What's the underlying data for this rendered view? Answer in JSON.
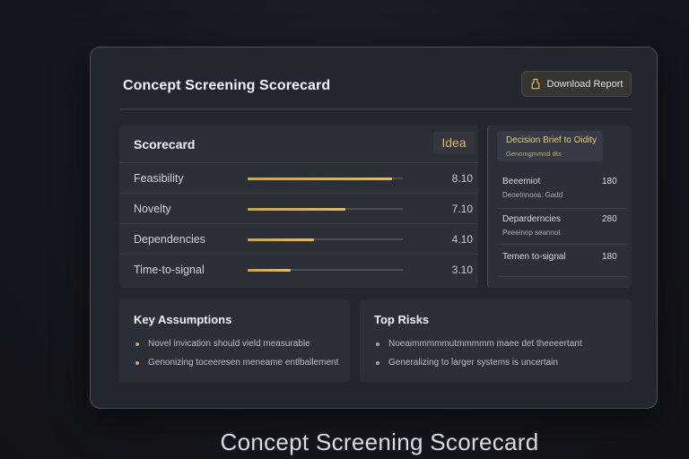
{
  "window": {
    "title": "Concept Screening Scorecard",
    "download_label": "Download Report"
  },
  "scorecard": {
    "title": "Scorecard",
    "tag": "Idea",
    "rows": [
      {
        "label": "Feasibility",
        "value": "8.10",
        "fill": 0.93
      },
      {
        "label": "Novelty",
        "value": "7.10",
        "fill": 0.63
      },
      {
        "label": "Dependencies",
        "value": "4.10",
        "fill": 0.43
      },
      {
        "label": "Time-to-signal",
        "value": "3.10",
        "fill": 0.28
      }
    ]
  },
  "brief": {
    "title": "Decision Brief to Oidity",
    "subtitle": "Genomgmmnd dts",
    "items": [
      {
        "name": "Beeemiot",
        "desc": "Deoetnnoos: Gadd",
        "value": "180"
      },
      {
        "name": "Deparderncies",
        "desc": "Peeeinop seannot",
        "value": "280"
      },
      {
        "name": "Temen to-signal",
        "desc": "",
        "value": "180"
      }
    ]
  },
  "assumptions": {
    "title": "Key Assumptions",
    "items": [
      "Novel invication should vield measurable",
      "Genonizing toceeresen meneame entlballement"
    ]
  },
  "risks": {
    "title": "Top Risks",
    "items": [
      "Noeaimmmmmutmmmmm maee det theeeertant",
      "Generalizing to larger systems is uncertain"
    ]
  },
  "caption": "Concept Screening Scorecard",
  "colors": {
    "accent": "#d8bb72",
    "panel": "#2a2f38",
    "window": "#22262f"
  }
}
